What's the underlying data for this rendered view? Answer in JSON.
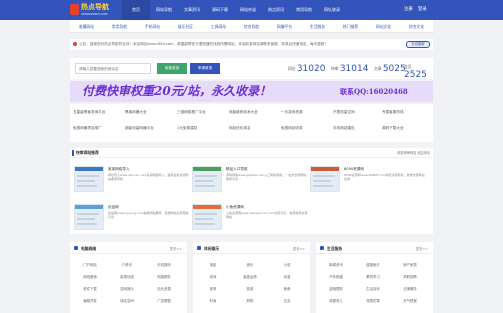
{
  "nav": {
    "logo_title": "热点导航",
    "logo_sub": "WWW.RDDH.COM",
    "items": [
      "首页",
      "网站导航",
      "文章资讯",
      "源码下载",
      "网站杂谈",
      "热点资讯",
      "常用导航",
      "网址收录"
    ],
    "active_index": 0,
    "login": "注册",
    "register": "登录"
  },
  "subnav": {
    "items": [
      "收藏网站",
      "常用导航",
      "手机网站",
      "娱乐社区",
      "工具网站",
      "综合导航",
      "网赚平台",
      "生活服务",
      "热门推荐",
      "网站文化",
      "综合文化"
    ]
  },
  "notice": {
    "text": "公告：感谢您对热点导航的支持！本站网址www.lif0d.com，希望能帮您方便快捷的找到所需网站，本站收录网站请联系客服，收录后快速排名，每天更新！",
    "kefu": "在线客服"
  },
  "search": {
    "placeholder": "请输入您要搜索的网站名",
    "free_btn": "免费收录",
    "add_btn": "申请收录"
  },
  "stats": [
    {
      "label": "网址",
      "value": "31020"
    },
    {
      "label": "待审",
      "value": "31014"
    },
    {
      "label": "文章",
      "value": "5025"
    },
    {
      "label": "会员",
      "value": "2525"
    }
  ],
  "ad": {
    "headline": "付费快审权重20元/站，永久收录！",
    "contact": "联系QQ:16020468"
  },
  "text_links": [
    "五星级黑客查询平台",
    "黑客网赚大全",
    "三维网络推广平台",
    "电脑维修技术大全",
    "一手游戏资源",
    "不限流量空间",
    "专属客服热线",
    "免费网赚项目推广",
    "超级流量网赚平台",
    "1元免费建站",
    "网站优化排名",
    "免费网站收录",
    "手机网站建设",
    "源码下载大全"
  ],
  "recommend": {
    "title": "快审网站推荐",
    "tip": "收录快审网站 欢迎申请",
    "cards": [
      {
        "title": "某某网络导入",
        "desc": "网址导入www.jiannan.com某某网络导入，提供最新资源网站收录导航"
      },
      {
        "title": "精品入口导航",
        "desc": "源码导航www.gsgitea.com入口网站导航，一站式优质网站收录平台"
      },
      {
        "title": "8090资源网",
        "desc": "8090资源网www.8090ff.com综合资源导航，收录优质网站资源"
      },
      {
        "title": "优品网",
        "desc": "优品网www.hyyong.com提供网站推荐，优质网站资源导航平台"
      },
      {
        "title": "小鱼资源网",
        "desc": "小鱼资源网www.xiaoseycom.com资源分享，免费收录资源网站"
      }
    ]
  },
  "panels": [
    {
      "title": "电脑网络",
      "more": "更多>>",
      "cells": [
        "门户网站",
        "IT资讯",
        "手机数码",
        "网络营销",
        "影视动漫",
        "电脑硬件",
        "软件下载",
        "游戏娱乐",
        "站长资源",
        "编程开发",
        "域名空间",
        "广告联盟"
      ]
    },
    {
      "title": "休闲娱乐",
      "more": "更多>>",
      "cells": [
        "电影",
        "音乐",
        "小说",
        "游戏",
        "星座运势",
        "动漫",
        "体育",
        "旅游",
        "美食",
        "时尚",
        "购物",
        "交友"
      ]
    },
    {
      "title": "生活服务",
      "more": "更多>>",
      "cells": [
        "新闻资讯",
        "健康医疗",
        "房产家居",
        "汽车频道",
        "教育学习",
        "求职招聘",
        "金融理财",
        "生活百科",
        "法律服务",
        "母婴育儿",
        "宠物花草",
        "天气预报"
      ]
    }
  ],
  "colors": {
    "primary": "#3355bb",
    "ad_text": "#6b2fd6",
    "ad_bg": "#e6dcfa",
    "logo_accent": "#ffd23f"
  }
}
